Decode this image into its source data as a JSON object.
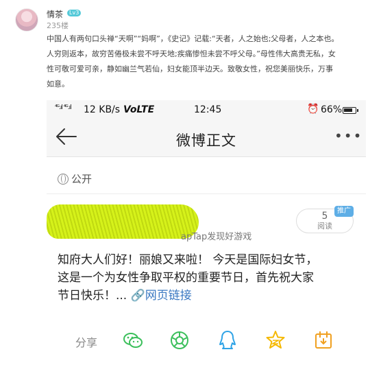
{
  "comment": {
    "username": "情茶",
    "level": "Lv3",
    "floor": "235楼",
    "text_lines": [
      "中国人有两句口头禅“天啊”“妈啊”，《史记》记载:“天者，人之始也;父母者，人之本也。",
      "人穷则返本，故穷苦倦极未尝不呼天地;疾痛惨怛未尝不呼父母。”母性伟大高贵无私，女",
      "性可敬可爱可亲，静如幽兰气若仙，妇女能顶半边天。致敬女性，祝您美丽快乐，万事",
      "如意。"
    ]
  },
  "phone": {
    "status_bar": {
      "signal": "⁴ᴳ.ıl ⁴ᴳ.ıl",
      "speed": "12 KB/s",
      "network": "VoLTE",
      "time": "12:45",
      "alarm": "⏰",
      "battery": "66%"
    },
    "nav": {
      "title": "微博正文",
      "more": "•••"
    },
    "visibility": "公开",
    "post": {
      "source": "apTap发现好游戏",
      "read_count": "5",
      "read_label": "阅读",
      "promo_tag": "推广",
      "lines": [
        "知府大人们好！丽娘又来啦！ 今天是国际妇女节，",
        "这是一个为女性争取平权的重要节日，首先祝大家"
      ],
      "last_line_text": "节日快乐！... ",
      "link_text": "网页链接"
    },
    "share": {
      "label": "分享",
      "icons": [
        "wechat-icon",
        "moments-icon",
        "qq-icon",
        "qzone-icon",
        "favorite-icon"
      ]
    }
  },
  "colors": {
    "link": "#3a78c2",
    "wechat": "#3bbf5b",
    "qq": "#2fa3e6",
    "qzone": "#f5b800",
    "favorite": "#f0a020",
    "scribble": "#d6f21a",
    "promo": "#5eaee6"
  }
}
